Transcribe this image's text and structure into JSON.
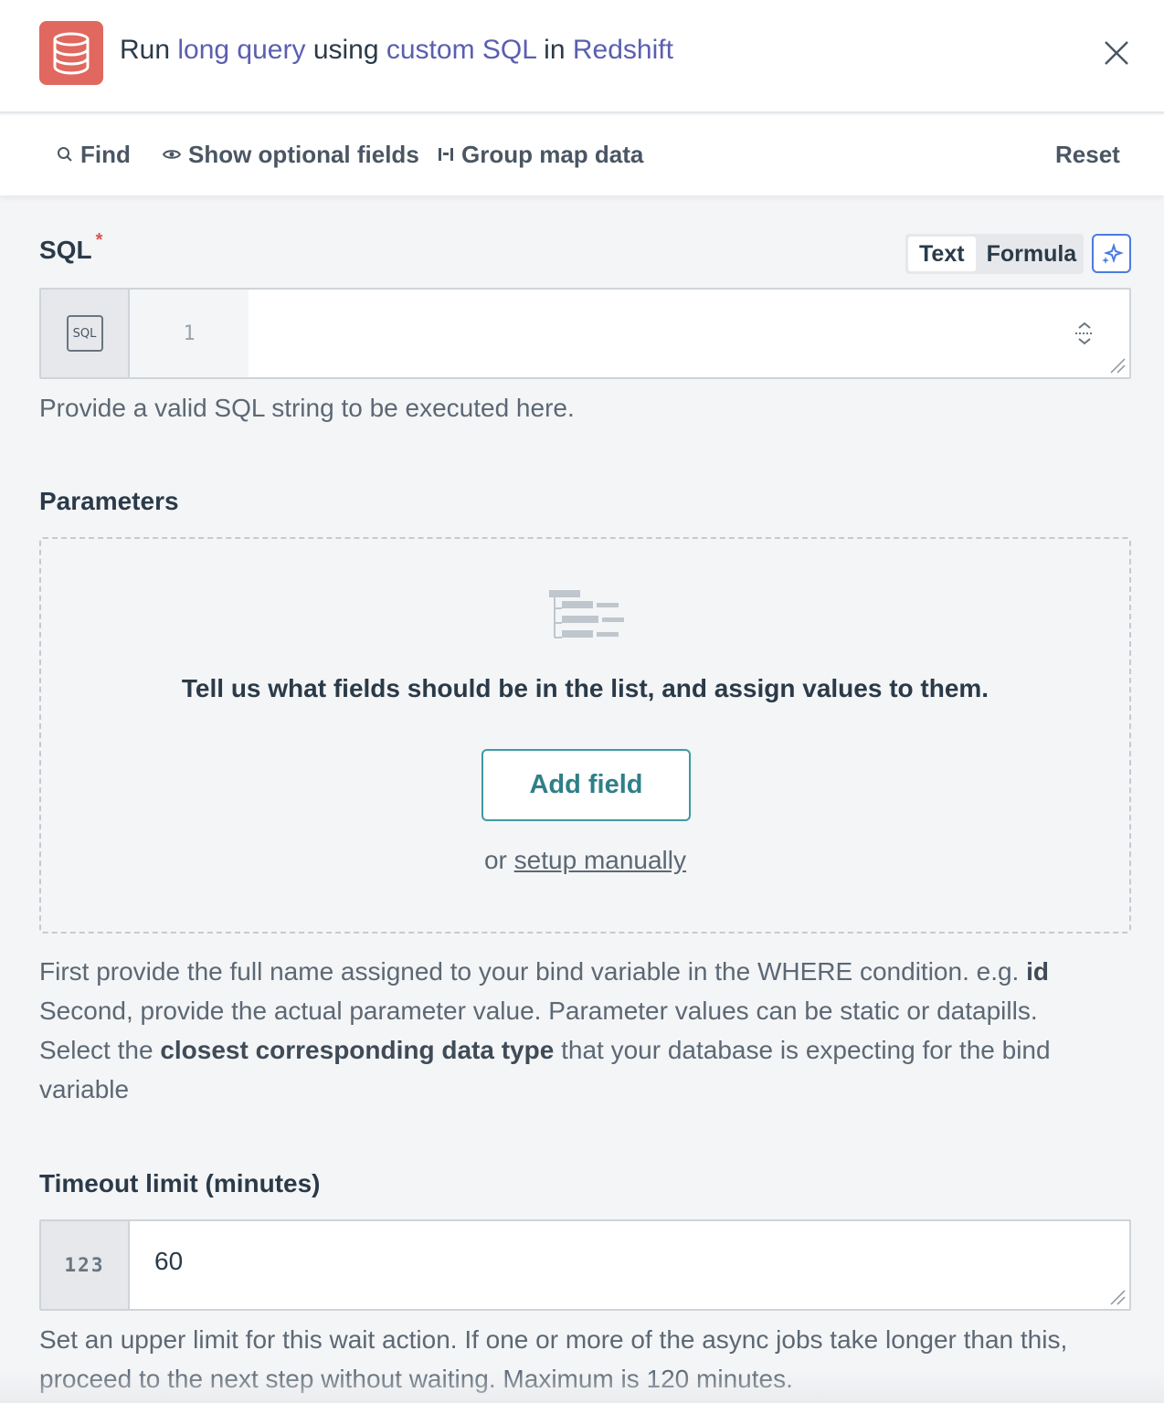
{
  "header": {
    "title_parts": [
      "Run ",
      "long query",
      " using ",
      "custom SQL",
      " in ",
      "Redshift"
    ],
    "app_icon": "database-icon",
    "close_icon": "close-icon"
  },
  "toolbar": {
    "find_label": "Find",
    "show_optional_label": "Show optional fields",
    "group_map_label": "Group map data",
    "reset_label": "Reset"
  },
  "sql_field": {
    "label": "SQL",
    "required_mark": "*",
    "mode_text": "Text",
    "mode_formula": "Formula",
    "type_badge": "SQL",
    "line_number": "1",
    "help": "Provide a valid SQL string to be executed here."
  },
  "parameters": {
    "label": "Parameters",
    "empty_message": "Tell us what fields should be in the list, and assign values to them.",
    "add_field_label": "Add field",
    "or_label": "or",
    "setup_manually_label": "setup manually",
    "help_line1": "First provide the full name assigned to your bind variable in the WHERE condition. e.g.",
    "help_line1_bold": "id",
    "help_line2": "Second, provide the actual parameter value. Parameter values can be static or datapills.",
    "help_line3_a": "Select the",
    "help_line3_bold": "closest corresponding data type",
    "help_line3_b": "that your database is expecting for the bind",
    "help_line4": "variable"
  },
  "timeout": {
    "label": "Timeout limit (minutes)",
    "type_badge": "123",
    "value": "60",
    "help_line1": "Set an upper limit for this wait action. If one or more of the async jobs take longer than this,",
    "help_line2": "proceed to the next step without waiting. Maximum is 120 minutes."
  },
  "colors": {
    "accent_link": "#5a5fb0",
    "app_icon_bg": "#e0685f",
    "add_field_border": "#3f9aa3",
    "ai_button_border": "#4a7be0"
  }
}
